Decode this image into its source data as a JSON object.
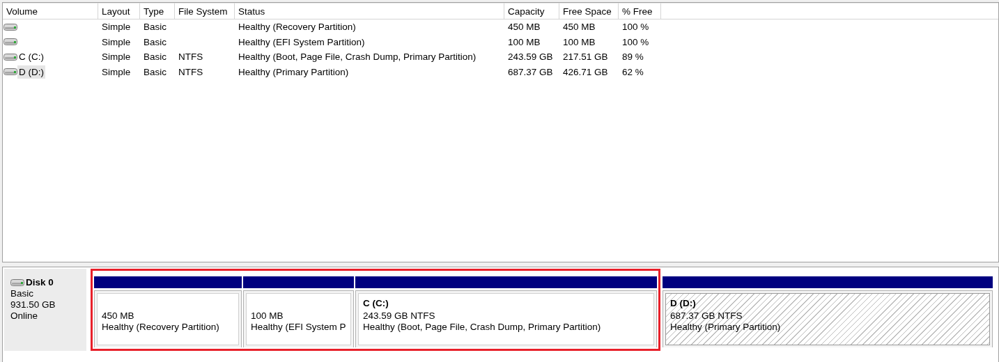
{
  "volume_list": {
    "columns": [
      "Volume",
      "Layout",
      "Type",
      "File System",
      "Status",
      "Capacity",
      "Free Space",
      "% Free"
    ],
    "rows": [
      {
        "volume": "",
        "layout": "Simple",
        "type": "Basic",
        "file_system": "",
        "status": "Healthy (Recovery Partition)",
        "capacity": "450 MB",
        "free_space": "450 MB",
        "percent_free": "100 %",
        "selected": false
      },
      {
        "volume": "",
        "layout": "Simple",
        "type": "Basic",
        "file_system": "",
        "status": "Healthy (EFI System Partition)",
        "capacity": "100 MB",
        "free_space": "100 MB",
        "percent_free": "100 %",
        "selected": false
      },
      {
        "volume": "C (C:)",
        "layout": "Simple",
        "type": "Basic",
        "file_system": "NTFS",
        "status": "Healthy (Boot, Page File, Crash Dump, Primary Partition)",
        "capacity": "243.59 GB",
        "free_space": "217.51 GB",
        "percent_free": "89 %",
        "selected": false
      },
      {
        "volume": "D (D:)",
        "layout": "Simple",
        "type": "Basic",
        "file_system": "NTFS",
        "status": "Healthy (Primary Partition)",
        "capacity": "687.37 GB",
        "free_space": "426.71 GB",
        "percent_free": "62 %",
        "selected": true
      }
    ]
  },
  "disk": {
    "name": "Disk 0",
    "type": "Basic",
    "size": "931.50 GB",
    "state": "Online",
    "partitions": [
      {
        "size": "450 MB",
        "status": "Healthy (Recovery Partition)",
        "selected": false,
        "highlighted": true
      },
      {
        "size": "100 MB",
        "status": "Healthy (EFI System P",
        "selected": false,
        "highlighted": true
      },
      {
        "name": "C  (C:)",
        "size": "243.59 GB NTFS",
        "status": "Healthy (Boot, Page File, Crash Dump, Primary Partition)",
        "selected": false,
        "highlighted": true
      },
      {
        "name": "D  (D:)",
        "size": "687.37 GB NTFS",
        "status": "Healthy (Primary Partition)",
        "selected": true,
        "highlighted": false
      }
    ]
  }
}
